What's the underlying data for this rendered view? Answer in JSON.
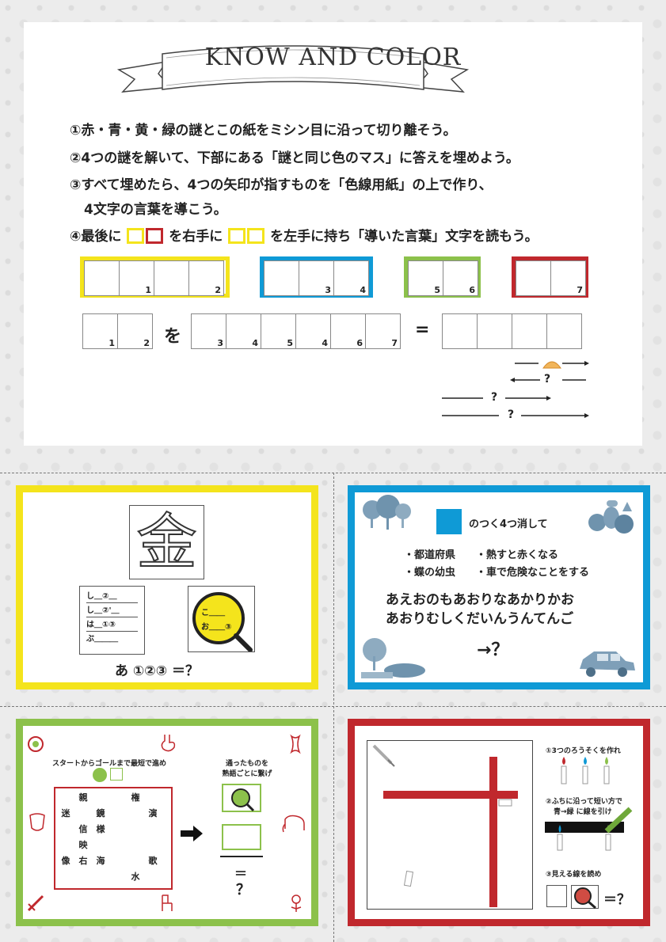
{
  "header": {
    "title": "KNOW AND COLOR"
  },
  "instructions": [
    "①赤・青・黄・緑の謎とこの紙をミシン目に沿って切り離そう。",
    "②4つの謎を解いて、下部にある「謎と同じ色のマス」に答えを埋めよう。",
    "③すべて埋めたら、4つの矢印が指すものを「色線用紙」の上で作り、",
    "4文字の言葉を導こう。"
  ],
  "instruction4": {
    "prefix": "④最後に",
    "mid": "を右手に",
    "suffix": "を左手に持ち「導いた言葉」文字を読もう。"
  },
  "colors": {
    "yellow": "#f4e41c",
    "blue": "#0f9ad6",
    "green": "#8cc14b",
    "red": "#c0282d"
  },
  "answer_boxes": {
    "yellow": [
      "",
      "1",
      "",
      "2"
    ],
    "blue": [
      "",
      "3",
      "4"
    ],
    "green": [
      "5",
      "6"
    ],
    "red": [
      "",
      "7"
    ]
  },
  "formula": {
    "left": [
      "1",
      "2"
    ],
    "wo": "を",
    "right": [
      "3",
      "4",
      "5",
      "4",
      "6",
      "7"
    ],
    "equals": "="
  },
  "hint_arrows": {
    "q": "?"
  },
  "yellow_card": {
    "kanji": "金",
    "words": [
      "し＿②＿",
      "し＿②'＿",
      "は＿①③",
      "ぶ＿＿＿"
    ],
    "lens_words": [
      "こ＿＿",
      "お＿＿③"
    ],
    "equation": "あ ①②③ ＝？"
  },
  "blue_card": {
    "title": "のつく4つ消して",
    "clues": [
      "・都道府県",
      "・熱すと赤くなる",
      "・蝶の幼虫",
      "・車で危険なことをする"
    ],
    "sequence": [
      "あえおのもあおりなあかりかお",
      "あおりむしくだいんうんてんご"
    ],
    "result": "→？"
  },
  "green_card": {
    "title": "スタートからゴールまで最短で進め",
    "right_title_1": "通ったものを",
    "right_title_2": "熟語ごとに繋げ",
    "grid": [
      [
        "",
        "親",
        "",
        "",
        "権",
        "",
        ""
      ],
      [
        "迷",
        "",
        "鏡",
        "",
        "",
        "演",
        ""
      ],
      [
        "",
        "信",
        "様",
        "",
        "",
        "",
        ""
      ],
      [
        "",
        "映",
        "",
        "",
        "",
        "",
        ""
      ],
      [
        "像",
        "右",
        "海",
        "",
        "",
        "歌",
        ""
      ],
      [
        "",
        "",
        "",
        "",
        "水",
        "",
        ""
      ],
      [
        "",
        "",
        "",
        "",
        "",
        "",
        ""
      ]
    ],
    "equals": "＝",
    "result": "？"
  },
  "red_card": {
    "step1": "①3つのろうそくを作れ",
    "step2a": "②ふちに沿って短い方で",
    "step2b": "青→緑 に線を引け",
    "step3": "③見える線を読め",
    "equation": "＝？"
  }
}
